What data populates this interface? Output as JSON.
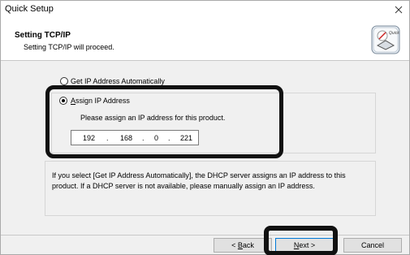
{
  "window": {
    "title": "Quick Setup"
  },
  "header": {
    "title": "Setting TCP/IP",
    "subtitle": "Setting TCP/IP will proceed.",
    "icon_badge": "Quick"
  },
  "options": {
    "auto": {
      "label": "Get IP Address Automatically",
      "selected": false
    },
    "assign": {
      "label_first": "A",
      "label_rest": "ssign IP Address",
      "selected": true
    }
  },
  "ip": {
    "prompt": "Please assign an IP address for this product.",
    "octet1": "192",
    "octet2": "168",
    "octet3": "0",
    "octet4": "221",
    "dot": "."
  },
  "info": {
    "text": "If you select [Get IP Address Automatically], the DHCP server assigns an IP address to this product. If a DHCP server is not available, please manually assign an IP address."
  },
  "buttons": {
    "back_prefix": "< ",
    "back_key": "B",
    "back_rest": "ack",
    "next_key": "N",
    "next_rest": "ext >",
    "cancel": "Cancel"
  },
  "colors": {
    "highlight": "#111111",
    "focus_border": "#0078d7"
  }
}
